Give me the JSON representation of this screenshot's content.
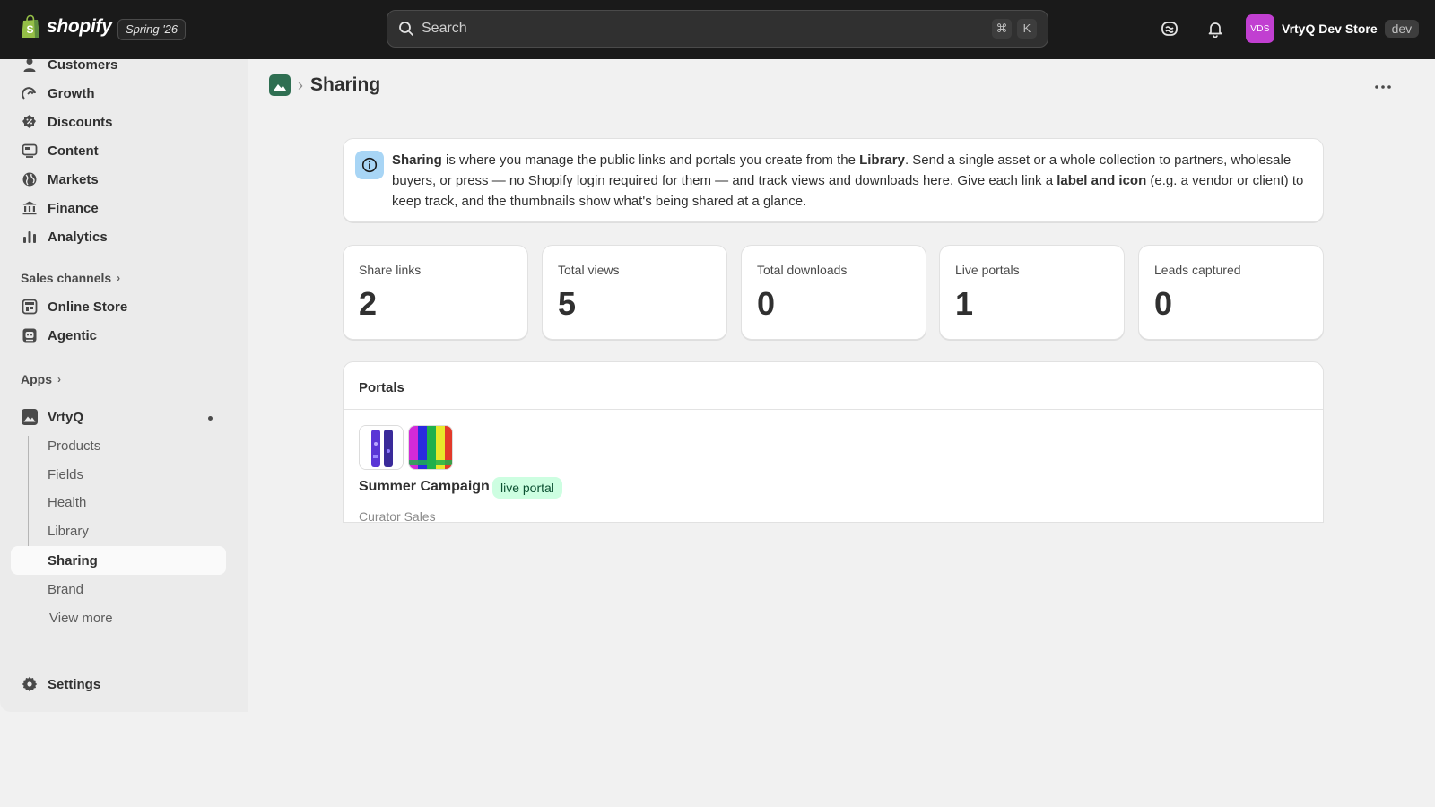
{
  "topbar": {
    "logo_text": "shopify",
    "edition": "Spring '26",
    "search_placeholder": "Search",
    "shortcut_keys": [
      "⌘",
      "K"
    ],
    "store_avatar_initials": "VDS",
    "store_name": "VrtyQ Dev Store",
    "store_badge": "dev",
    "icons": [
      "shopify-bag-icon",
      "search-icon",
      "sidekick-icon",
      "bell-icon"
    ]
  },
  "sidebar": {
    "main_items": [
      {
        "label": "Customers",
        "icon": "person-icon"
      },
      {
        "label": "Growth",
        "icon": "growth-icon"
      },
      {
        "label": "Discounts",
        "icon": "discount-icon"
      },
      {
        "label": "Content",
        "icon": "content-icon"
      },
      {
        "label": "Markets",
        "icon": "globe-icon"
      },
      {
        "label": "Finance",
        "icon": "bank-icon"
      },
      {
        "label": "Analytics",
        "icon": "bar-chart-icon"
      }
    ],
    "sales_channels_label": "Sales channels",
    "channels": [
      {
        "label": "Online Store",
        "icon": "store-icon"
      },
      {
        "label": "Agentic",
        "icon": "agentic-icon"
      }
    ],
    "apps_label": "Apps",
    "app": {
      "label": "VrtyQ",
      "icon": "image-icon",
      "sub_items": [
        "Products",
        "Fields",
        "Health",
        "Library",
        "Sharing",
        "Brand"
      ],
      "active": "Sharing"
    },
    "view_more": "View more",
    "settings_label": "Settings"
  },
  "page": {
    "title": "Sharing",
    "info": {
      "b1": "Sharing",
      "t1": " is where you manage the public links and portals you create from the ",
      "b2": "Library",
      "t2": ". Send a single asset or a whole collection to partners, wholesale buyers, or press — no Shopify login required for them — and track views and downloads here. Give each link a ",
      "b3": "label and icon",
      "t3": " (e.g. a vendor or client) to keep track, and the thumbnails show what's being shared at a glance."
    },
    "stats": [
      {
        "label": "Share links",
        "value": "2"
      },
      {
        "label": "Total views",
        "value": "5"
      },
      {
        "label": "Total downloads",
        "value": "0"
      },
      {
        "label": "Live portals",
        "value": "1"
      },
      {
        "label": "Leads captured",
        "value": "0"
      }
    ],
    "portals": {
      "title": "Portals",
      "items": [
        {
          "name": "Summer Campaign",
          "badge": "live portal",
          "subtitle": "Curator Sales"
        }
      ]
    }
  },
  "colors": {
    "topbar_bg": "#1a1a1a",
    "store_avatar": "#c13fd1",
    "info_icon_bg": "#a8d5f5",
    "badge_bg": "#cdfee1",
    "badge_text": "#0c5132"
  }
}
